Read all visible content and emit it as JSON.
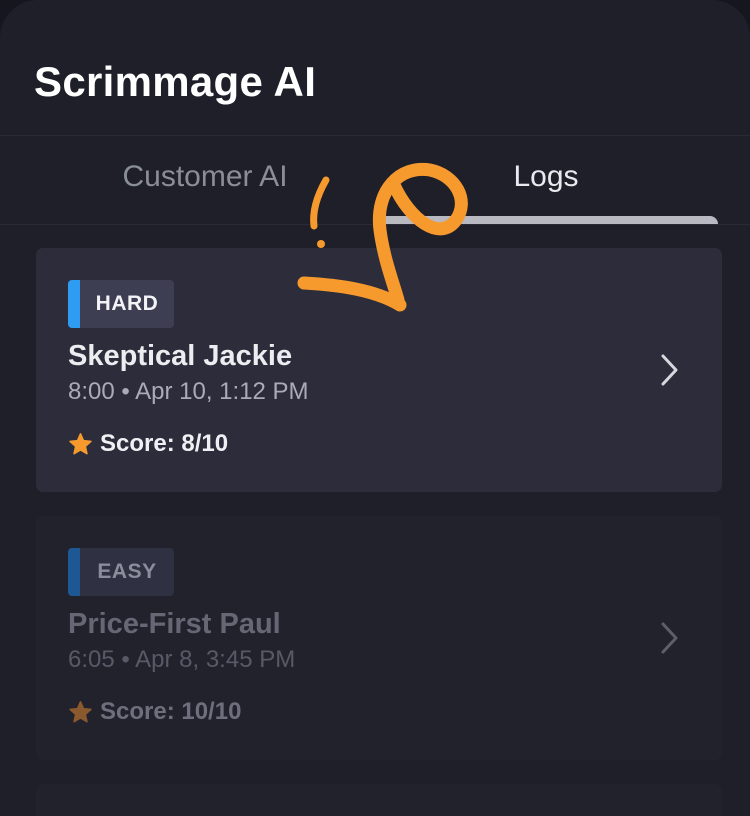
{
  "app": {
    "title": "Scrimmage AI"
  },
  "tabs": [
    {
      "label": "Customer AI",
      "active": false
    },
    {
      "label": "Logs",
      "active": true
    }
  ],
  "logs": [
    {
      "difficulty": "HARD",
      "difficulty_color": "#2f9cf4",
      "persona": "Skeptical Jackie",
      "meta": "8:00 • Apr 10, 1:12 PM",
      "score": "Score: 8/10",
      "star_color": "#f79a2e"
    },
    {
      "difficulty": "EASY",
      "difficulty_color": "#1d5794",
      "persona": "Price-First Paul",
      "meta": "6:05 • Apr 8, 3:45 PM",
      "score": "Score: 10/10",
      "star_color": "#8a5a2e"
    }
  ],
  "icons": {
    "star": "star-icon",
    "chevron": "chevron-right-icon",
    "annotation": "curly-arrow-icon"
  },
  "colors": {
    "accent_orange": "#f79a2e",
    "background": "#1f1f29",
    "card": "#2c2c3a"
  }
}
